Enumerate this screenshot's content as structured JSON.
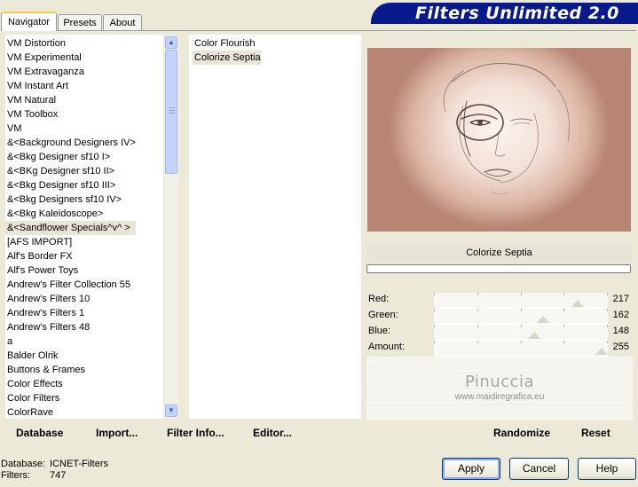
{
  "tabs": [
    {
      "label": "Navigator",
      "active": true
    },
    {
      "label": "Presets",
      "active": false
    },
    {
      "label": "About",
      "active": false
    }
  ],
  "title": "Filters Unlimited 2.0",
  "categories": {
    "items": [
      "VM Distortion",
      "VM Experimental",
      "VM Extravaganza",
      "VM Instant Art",
      "VM Natural",
      "VM Toolbox",
      "VM",
      "&<Background Designers IV>",
      "&<Bkg Designer sf10 I>",
      "&<BKg Designer sf10 II>",
      "&<Bkg Designer sf10 III>",
      "&<Bkg Designers sf10 IV>",
      "&<Bkg Kaleidoscope>",
      "&<Sandflower Specials^v^ >",
      "[AFS IMPORT]",
      "Alf's Border FX",
      "Alf's Power Toys",
      "Andrew's Filter Collection 55",
      "Andrew's Filters 10",
      "Andrew's Filters 1",
      "Andrew's Filters 48",
      "a",
      "Balder Olrik",
      "Buttons & Frames",
      "Color Effects",
      "Color Filters",
      "ColorRave"
    ],
    "selected_index": 13
  },
  "filters": {
    "items": [
      "Color Flourish",
      "Colorize Septia"
    ],
    "selected_index": 1
  },
  "toolbar": {
    "database": "Database",
    "import": "Import...",
    "filter_info": "Filter Info...",
    "editor": "Editor...",
    "randomize": "Randomize",
    "reset": "Reset"
  },
  "preview": {
    "filter_name": "Colorize Septia",
    "image_tint": "#e9c8b8"
  },
  "sliders": [
    {
      "label": "Red:",
      "value": "217",
      "level": 0.851
    },
    {
      "label": "Green:",
      "value": "162",
      "level": 0.635
    },
    {
      "label": "Blue:",
      "value": "148",
      "level": 0.58
    },
    {
      "label": "Amount:",
      "value": "255",
      "level": 1.0
    }
  ],
  "watermark": {
    "name": "Pinuccia",
    "site": "www.maidiregrafica.eu"
  },
  "status": {
    "database_label": "Database:",
    "database_value": "ICNET-Filters",
    "filters_label": "Filters:",
    "filters_value": "747"
  },
  "buttons": {
    "apply": "Apply",
    "cancel": "Cancel",
    "help": "Help"
  },
  "colors": {
    "banner": "#0a1a8c",
    "accent_tab": "#ffc83c",
    "selection": "#e8e4d8"
  }
}
